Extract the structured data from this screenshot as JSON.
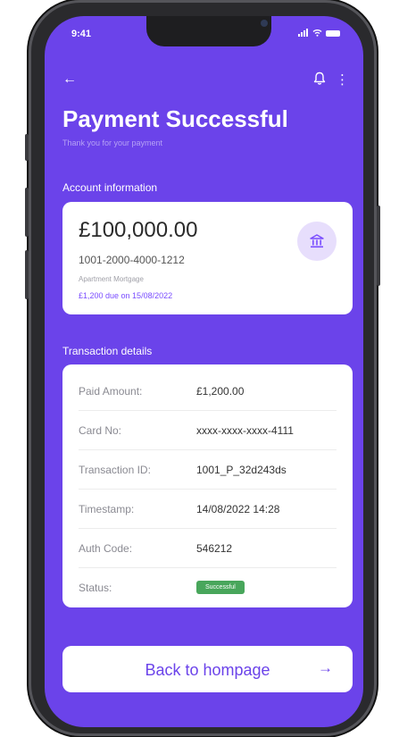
{
  "status_bar": {
    "time": "9:41",
    "signal_icon": "signal-icon",
    "wifi_icon": "wifi-icon",
    "battery_icon": "battery-icon"
  },
  "nav": {
    "back_icon": "back-arrow-icon",
    "back_glyph": "←",
    "notification_icon": "bell-icon",
    "more_icon": "more-vertical-icon",
    "more_glyph": "⋮"
  },
  "header": {
    "title": "Payment Successful",
    "subtitle": "Thank you for your payment"
  },
  "account": {
    "section_label": "Account information",
    "balance": "£100,000.00",
    "number": "1001-2000-4000-1212",
    "name": "Apartment Mortgage",
    "due": "£1,200 due on 15/08/2022",
    "icon": "bank-icon"
  },
  "transaction": {
    "section_label": "Transaction details",
    "rows": [
      {
        "label": "Paid Amount:",
        "value": "£1,200.00"
      },
      {
        "label": "Card No:",
        "value": "xxxx-xxxx-xxxx-4111"
      },
      {
        "label": "Transaction ID:",
        "value": "1001_P_32d243ds"
      },
      {
        "label": "Timestamp:",
        "value": "14/08/2022 14:28"
      },
      {
        "label": "Auth Code:",
        "value": "546212"
      },
      {
        "label": "Status:",
        "value": "Successful"
      }
    ]
  },
  "footer": {
    "home_button_label": "Back to hompage",
    "arrow_icon": "arrow-right-icon",
    "arrow_glyph": "→"
  },
  "colors": {
    "primary": "#6b43ea",
    "card": "#ffffff",
    "success": "#48a65b",
    "due_text": "#7a4dff"
  }
}
